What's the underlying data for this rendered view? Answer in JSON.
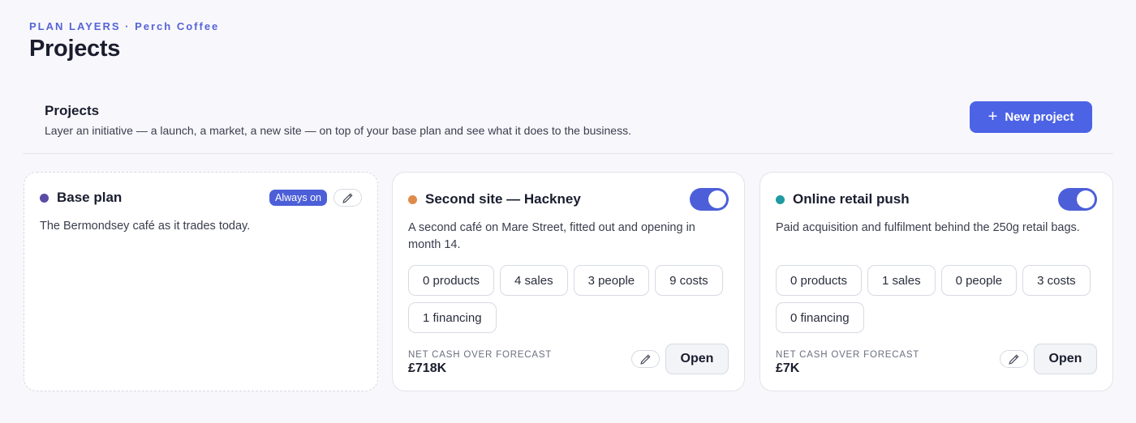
{
  "header": {
    "eyebrow": "PLAN LAYERS · Perch Coffee",
    "title": "Projects"
  },
  "section": {
    "title": "Projects",
    "description": "Layer an initiative — a launch, a market, a new site — on top of your base plan and see what it does to the business.",
    "new_button_label": "New project",
    "new_button_icon": "plus-icon"
  },
  "colors": {
    "accent": "#4c63e6",
    "base_dot": "#5b4ba6",
    "hackney_dot": "#e08a4a",
    "online_dot": "#1f9aa0"
  },
  "cards": [
    {
      "name": "Base plan",
      "dot_color": "#5b4ba6",
      "badge": "Always on",
      "description": "The Bermondsey café as it trades today.",
      "edit_icon": "pencil-icon"
    },
    {
      "name": "Second site — Hackney",
      "dot_color": "#e08a4a",
      "toggle_on": true,
      "description": "A second café on Mare Street, fitted out and opening in month 14.",
      "chips": [
        "0 products",
        "4 sales",
        "3 people",
        "9 costs",
        "1 financing"
      ],
      "metric_label": "NET CASH OVER FORECAST",
      "metric_value": "£718K",
      "open_label": "Open",
      "edit_icon": "pencil-icon"
    },
    {
      "name": "Online retail push",
      "dot_color": "#1f9aa0",
      "toggle_on": true,
      "description": "Paid acquisition and fulfilment behind the 250g retail bags.",
      "chips": [
        "0 products",
        "1 sales",
        "0 people",
        "3 costs",
        "0 financing"
      ],
      "metric_label": "NET CASH OVER FORECAST",
      "metric_value": "£7K",
      "open_label": "Open",
      "edit_icon": "pencil-icon"
    }
  ]
}
